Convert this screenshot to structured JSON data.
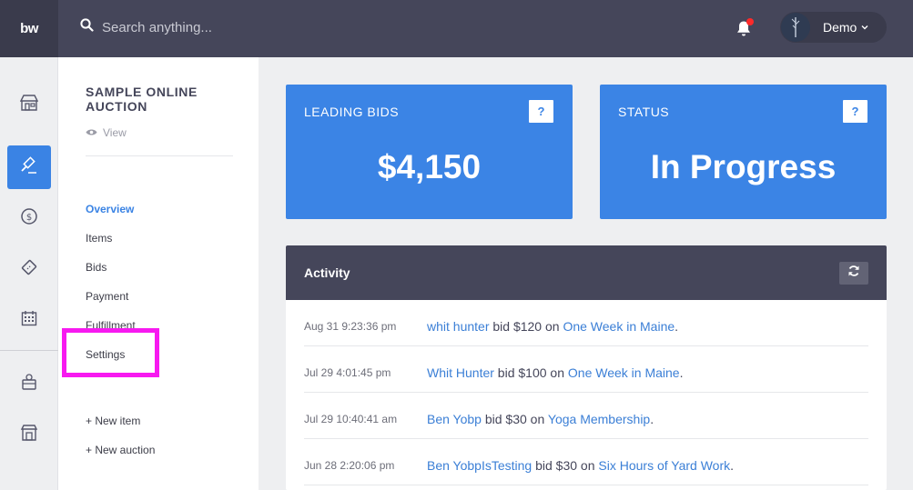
{
  "topbar": {
    "logo": "bw",
    "search_placeholder": "Search anything...",
    "user_name": "Demo",
    "notification_dot_color": "#ff2a2a"
  },
  "rail": {
    "items": [
      {
        "icon": "store-icon"
      },
      {
        "icon": "gavel-icon",
        "active": true
      },
      {
        "icon": "dollar-coin-icon"
      },
      {
        "icon": "ticket-icon"
      },
      {
        "icon": "calendar-icon"
      },
      {
        "icon": "donation-box-icon"
      },
      {
        "icon": "storefront-icon"
      }
    ]
  },
  "subnav": {
    "auction_title": "SAMPLE ONLINE AUCTION",
    "view_label": "View",
    "links": {
      "overview": "Overview",
      "items": "Items",
      "bids": "Bids",
      "payment": "Payment",
      "fulfillment": "Fulfillment",
      "settings": "Settings",
      "new_item": "+ New item",
      "new_auction": "+ New auction"
    }
  },
  "cards": {
    "leading_bids": {
      "label": "LEADING BIDS",
      "help": "?",
      "value": "$4,150"
    },
    "status": {
      "label": "STATUS",
      "help": "?",
      "value": "In Progress"
    }
  },
  "activity": {
    "title": "Activity",
    "rows": [
      {
        "time": "Aug 31 9:23:36 pm",
        "user": "whit hunter",
        "mid": " bid $120 on ",
        "item": "One Week in Maine",
        "end": "."
      },
      {
        "time": "Jul 29 4:01:45 pm",
        "user": "Whit Hunter",
        "mid": " bid $100 on ",
        "item": "One Week in Maine",
        "end": "."
      },
      {
        "time": "Jul 29 10:40:41 am",
        "user": "Ben Yobp",
        "mid": " bid $30 on ",
        "item": "Yoga Membership",
        "end": "."
      },
      {
        "time": "Jun 28 2:20:06 pm",
        "user": "Ben YobpIsTesting",
        "mid": " bid $30 on ",
        "item": "Six Hours of Yard Work",
        "end": "."
      }
    ]
  },
  "colors": {
    "accent": "#3b84e5",
    "topbar": "#45465a",
    "highlight": "#f719f0"
  }
}
